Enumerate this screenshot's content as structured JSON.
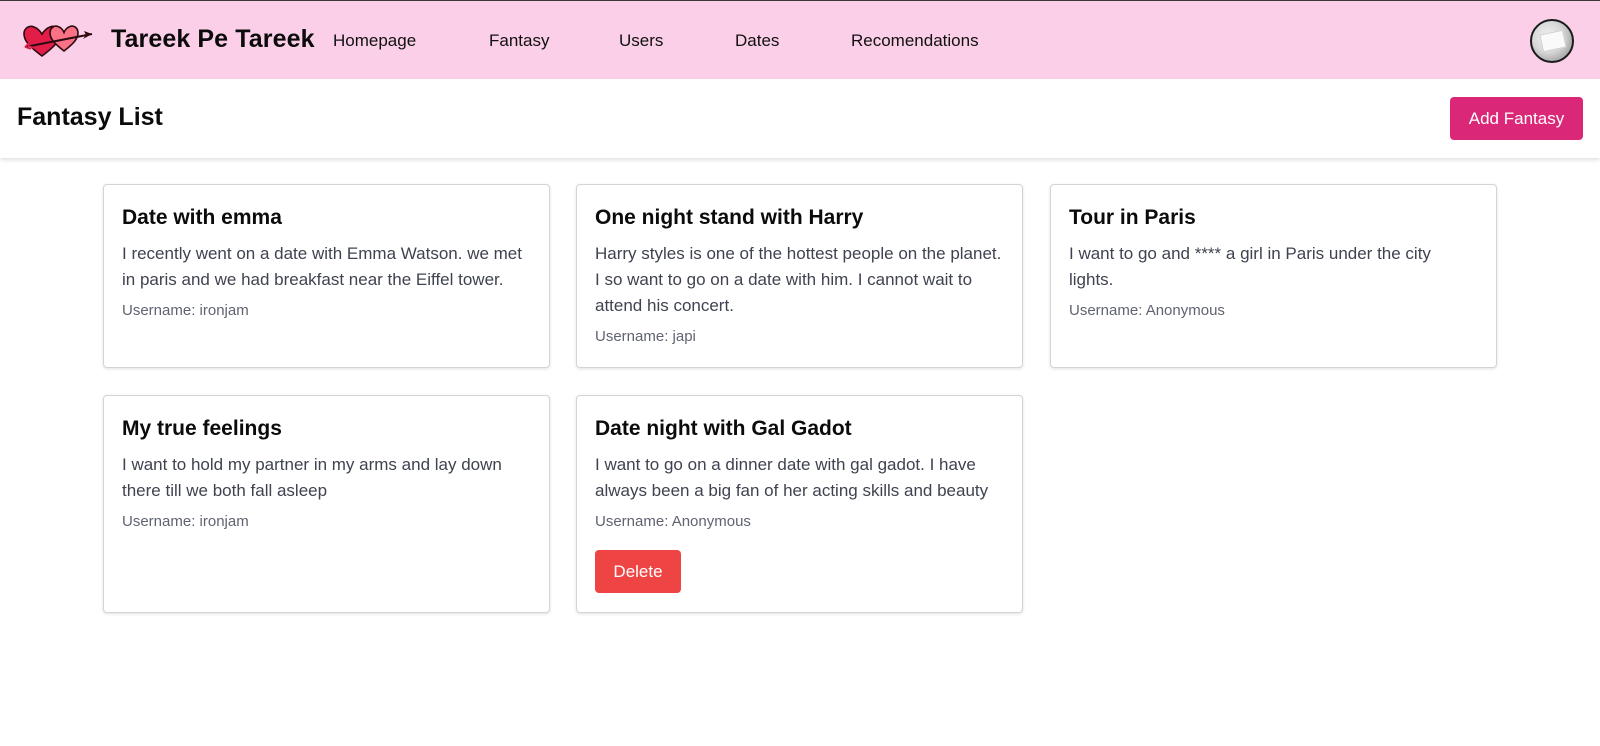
{
  "brand": {
    "name": "Tareek Pe Tareek",
    "logo_icon": "hearts-arrow-icon"
  },
  "nav": {
    "items": [
      {
        "label": "Homepage"
      },
      {
        "label": "Fantasy"
      },
      {
        "label": "Users"
      },
      {
        "label": "Dates"
      },
      {
        "label": "Recomendations"
      }
    ]
  },
  "header": {
    "title": "Fantasy List",
    "add_label": "Add Fantasy"
  },
  "cards": [
    {
      "title": "Date with emma",
      "text": "I recently went on a date with Emma Watson. we met in paris and we had breakfast near the Eiffel tower.",
      "username": "Username: ironjam"
    },
    {
      "title": "One night stand with Harry",
      "text": "Harry styles is one of the hottest people on the planet. I so want to go on a date with him. I cannot wait to attend his concert.",
      "username": "Username: japi"
    },
    {
      "title": "Tour in Paris",
      "text": "I want to go and **** a girl in Paris under the city lights.",
      "username": "Username: Anonymous"
    },
    {
      "title": "My true feelings",
      "text": "I want to hold my partner in my arms and lay down there till we both fall asleep",
      "username": "Username: ironjam"
    },
    {
      "title": "Date night with Gal Gadot",
      "text": "I want to go on a dinner date with gal gadot. I have always been a big fan of her acting skills and beauty",
      "username": "Username: Anonymous",
      "delete_label": "Delete"
    }
  ],
  "colors": {
    "topbar": "#fbcfe8",
    "primary": "#db2777",
    "danger": "#ef4444"
  }
}
